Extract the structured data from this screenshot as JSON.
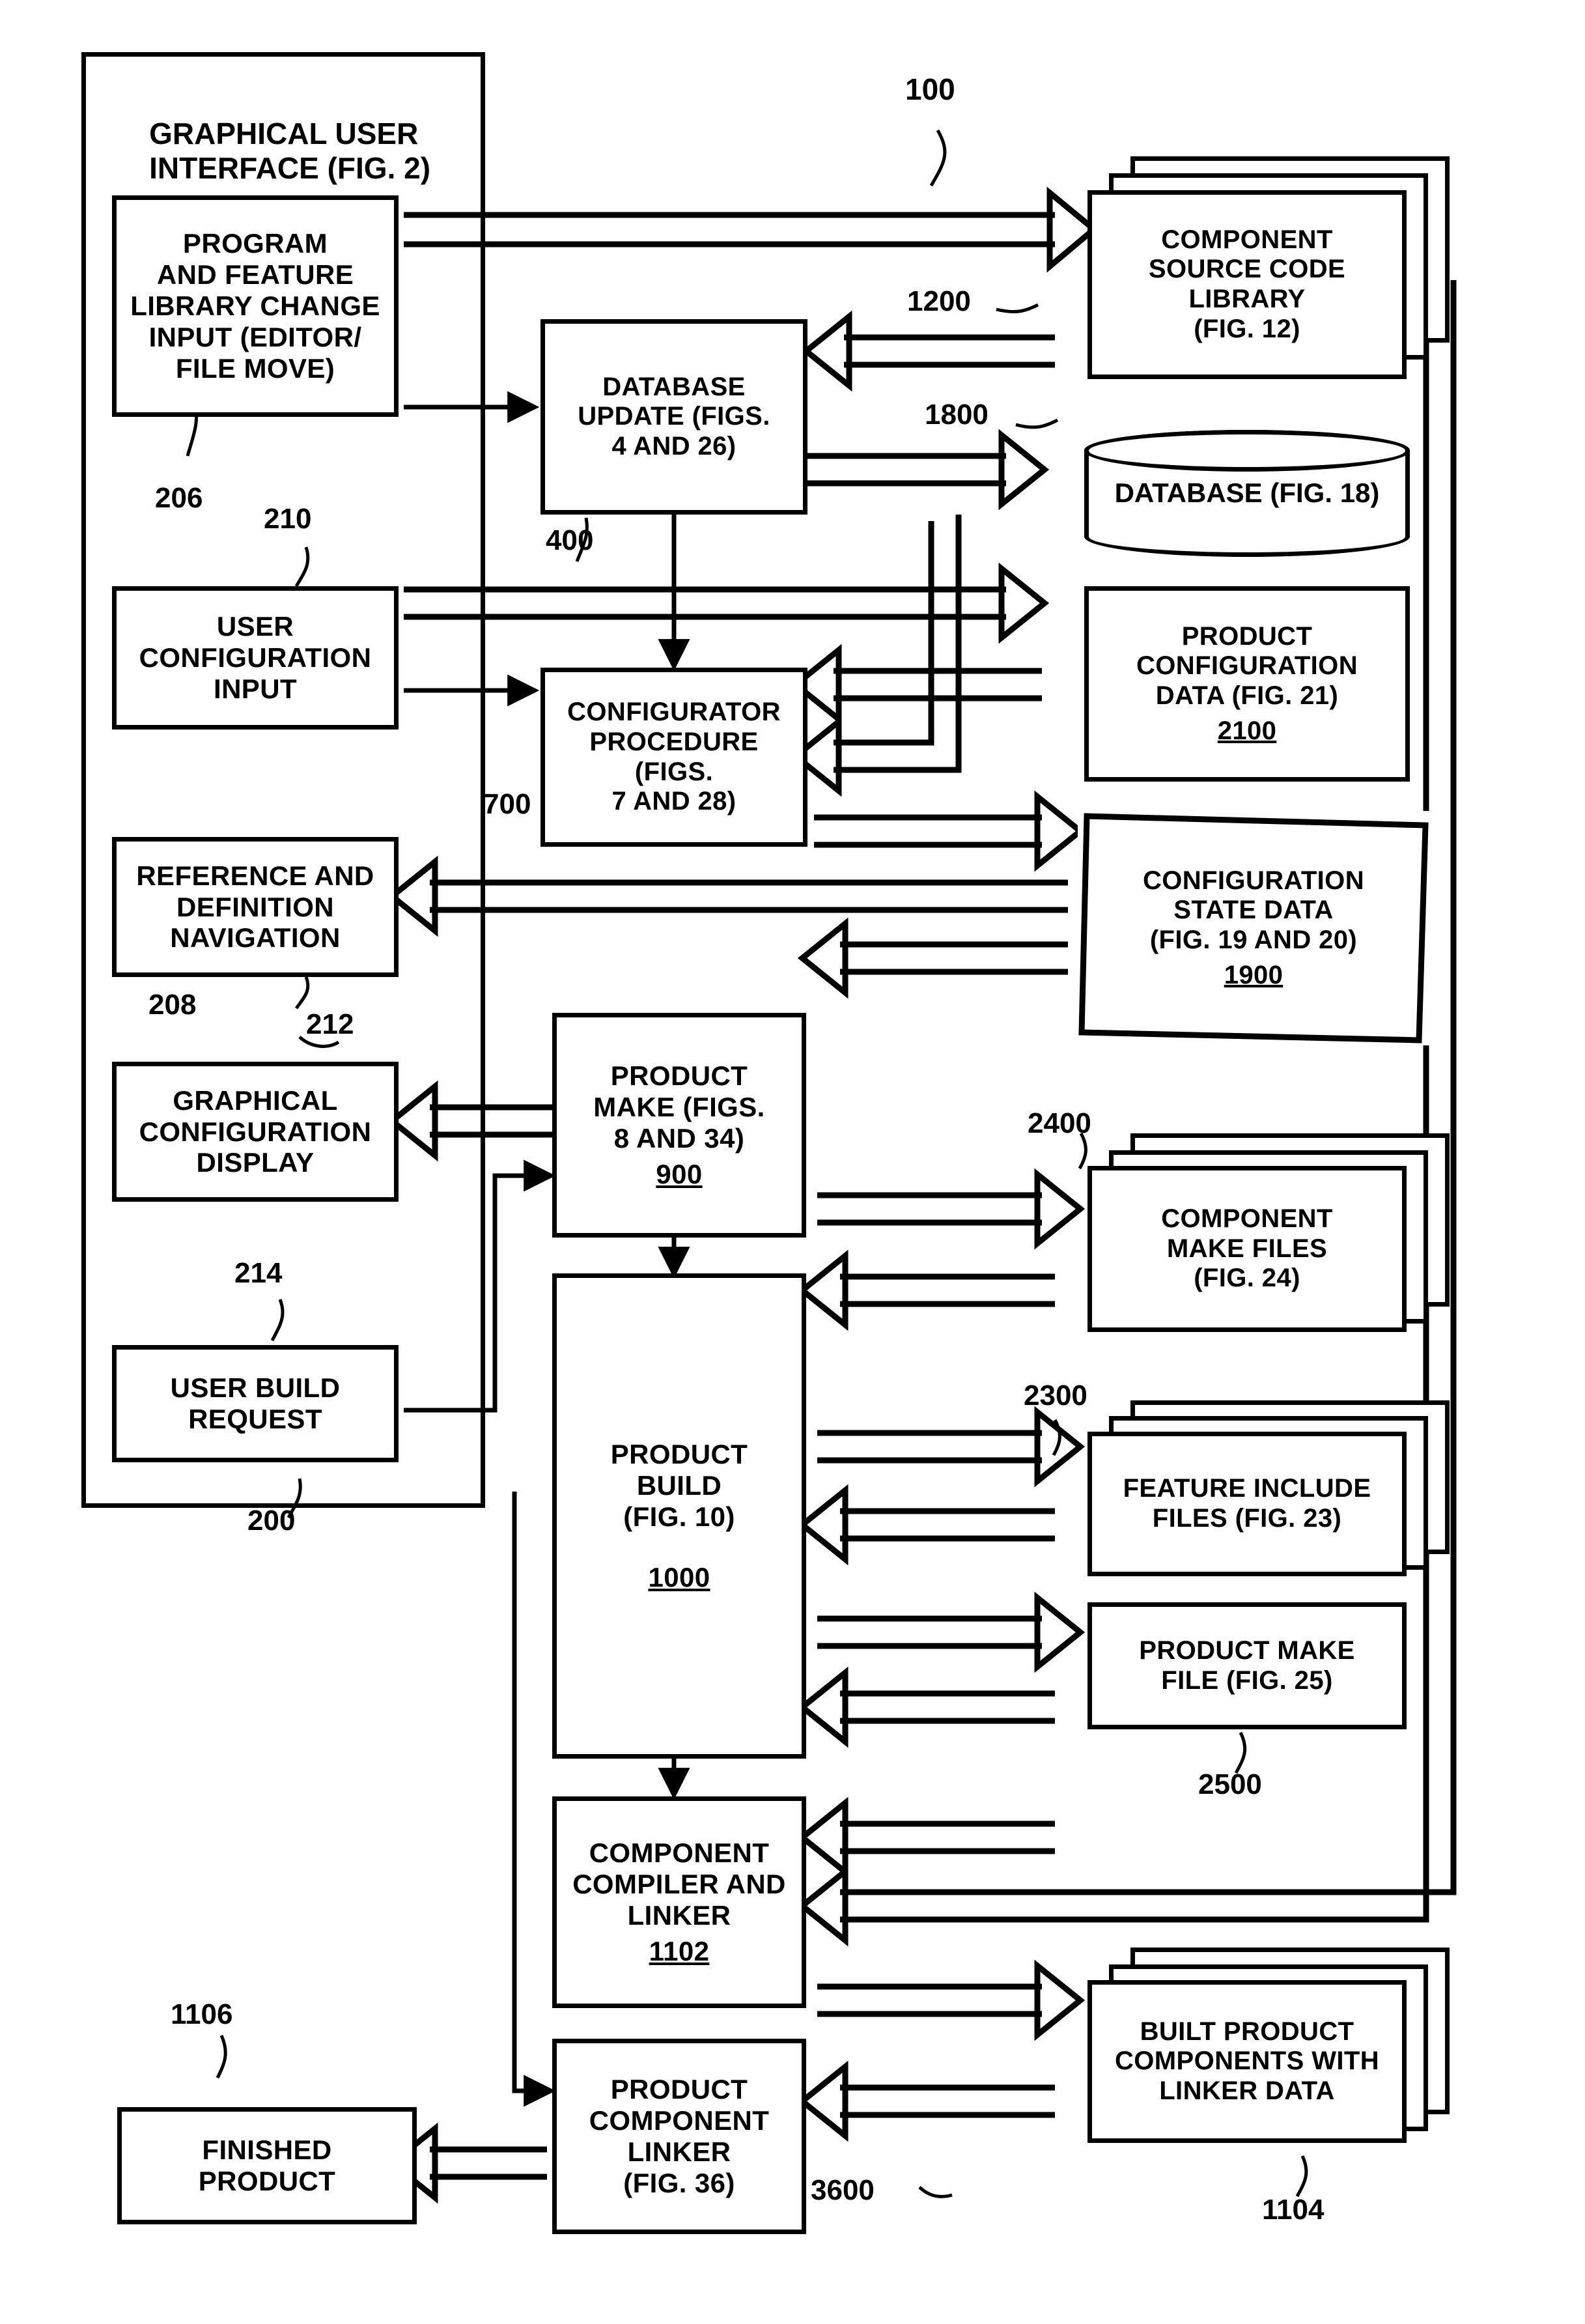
{
  "figure": {
    "main_ref": "100",
    "gui_panel": {
      "title_line1": "GRAPHICAL USER",
      "title_line2": "INTERFACE (FIG. 2)",
      "ref": "200"
    }
  },
  "nodes": {
    "program_input": {
      "lines": [
        "PROGRAM",
        "AND FEATURE",
        "LIBRARY CHANGE",
        "INPUT (EDITOR/",
        "FILE MOVE)"
      ],
      "ref": "206"
    },
    "user_config_input": {
      "lines": [
        "USER",
        "CONFIGURATION",
        "INPUT"
      ],
      "ref": "210"
    },
    "reference_navigation": {
      "lines": [
        "REFERENCE AND",
        "DEFINITION",
        "NAVIGATION"
      ],
      "ref": "208"
    },
    "graphical_config_display": {
      "lines": [
        "GRAPHICAL",
        "CONFIGURATION",
        "DISPLAY"
      ],
      "ref": "212"
    },
    "user_build_request": {
      "lines": [
        "USER BUILD",
        "REQUEST"
      ],
      "ref": "214"
    },
    "database_update": {
      "lines": [
        "DATABASE",
        "UPDATE (FIGS.",
        "4 AND 26)"
      ],
      "ref": "400"
    },
    "configurator_procedure": {
      "lines": [
        "CONFIGURATOR",
        "PROCEDURE",
        "(FIGS.",
        "7 AND 28)"
      ],
      "ref": "700"
    },
    "product_make": {
      "lines": [
        "PRODUCT",
        "MAKE (FIGS.",
        "8 AND 34)"
      ],
      "ref": "900"
    },
    "product_build": {
      "lines": [
        "PRODUCT",
        "BUILD",
        "(FIG. 10)"
      ],
      "ref": "1000"
    },
    "component_compiler_linker": {
      "lines": [
        "COMPONENT",
        "COMPILER AND",
        "LINKER"
      ],
      "ref": "1102"
    },
    "product_component_linker": {
      "lines": [
        "PRODUCT",
        "COMPONENT",
        "LINKER",
        "(FIG. 36)"
      ],
      "ref": "3600"
    },
    "finished_product": {
      "lines": [
        "FINISHED",
        "PRODUCT"
      ],
      "ref": "1106"
    },
    "component_source_code_library": {
      "lines": [
        "COMPONENT",
        "SOURCE CODE",
        "LIBRARY",
        "(FIG. 12)"
      ],
      "ref": "1200"
    },
    "database": {
      "lines": [
        "DATABASE",
        "(FIG. 18)"
      ],
      "ref": "1800"
    },
    "product_configuration_data": {
      "lines": [
        "PRODUCT",
        "CONFIGURATION",
        "DATA (FIG. 21)"
      ],
      "ref": "2100"
    },
    "configuration_state_data": {
      "lines": [
        "CONFIGURATION",
        "STATE DATA",
        "(FIG. 19 AND 20)"
      ],
      "ref": "1900"
    },
    "component_make_files": {
      "lines": [
        "COMPONENT",
        "MAKE FILES",
        "(FIG. 24)"
      ],
      "ref": "2400"
    },
    "feature_include_files": {
      "lines": [
        "FEATURE INCLUDE",
        "FILES (FIG. 23)"
      ],
      "ref": "2300"
    },
    "product_make_file": {
      "lines": [
        "PRODUCT MAKE",
        "FILE (FIG. 25)"
      ],
      "ref": "2500"
    },
    "built_product_components": {
      "lines": [
        "BUILT PRODUCT",
        "COMPONENTS WITH",
        "LINKER DATA"
      ],
      "ref": "1104"
    }
  },
  "colors": {
    "ink": "#000000",
    "paper": "#ffffff"
  }
}
